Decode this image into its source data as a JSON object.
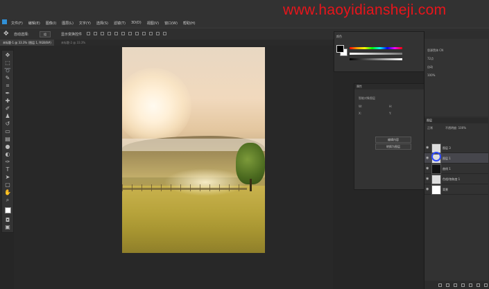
{
  "app": {
    "name": "Photoshop"
  },
  "watermark": "www.haoyidiansheji.com",
  "menubar": {
    "items": [
      "文件(F)",
      "编辑(E)",
      "图像(I)",
      "图层(L)",
      "文字(Y)",
      "选择(S)",
      "滤镜(T)",
      "3D(D)",
      "视图(V)",
      "窗口(W)",
      "帮助(H)"
    ]
  },
  "options": {
    "auto_select_label": "自动选择:",
    "auto_select_value": "组",
    "transform_label": "显示变换控件"
  },
  "document": {
    "tab_label": "未标题-1 @ 33.3% (图层 1, RGB/8#)",
    "tab2_label": "未标题-2 @ 33.3%"
  },
  "color_panel": {
    "title": "颜色",
    "fg_color": "#000000",
    "bg_color": "#ffffff"
  },
  "properties": {
    "title": "属性",
    "sublabel": "智能对象图层",
    "w_label": "W:",
    "h_label": "H:",
    "x_label": "X:",
    "y_label": "Y:",
    "btn1": "编辑内容",
    "btn2": "转换为图层"
  },
  "character": {
    "font_label": "思源黑体 CN",
    "size_label": "72点",
    "leading_label": "自动",
    "scale_label": "100%"
  },
  "layers": {
    "title": "图层",
    "blend_mode": "正常",
    "opacity_label": "不透明度: 100%",
    "items": [
      {
        "name": "图层 3",
        "visible": true
      },
      {
        "name": "图层 1",
        "visible": true,
        "selected": true
      },
      {
        "name": "曲线 1",
        "visible": true
      },
      {
        "name": "色相/饱和度 1",
        "visible": true
      },
      {
        "name": "背景",
        "visible": true
      }
    ]
  },
  "colors": {
    "accent": "#31a8ff",
    "watermark": "#e8151b",
    "cursor_ring": "#2f4bff"
  }
}
